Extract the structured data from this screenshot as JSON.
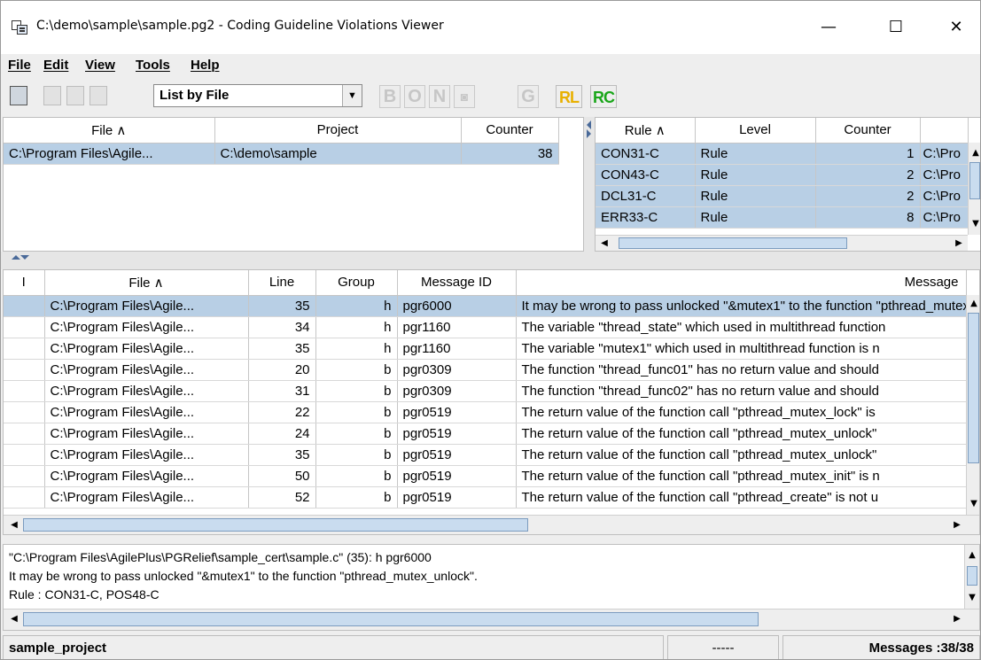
{
  "window": {
    "title": "C:\\demo\\sample\\sample.pg2 - Coding Guideline Violations Viewer",
    "minimize": "—",
    "maximize": "☐",
    "close": "✕"
  },
  "menu": [
    "File",
    "Edit",
    "View",
    "Tools",
    "Help"
  ],
  "toolbar": {
    "view_mode": "List by File",
    "letter_buttons": [
      "B",
      "O",
      "N",
      "◙",
      "G"
    ],
    "rl_label": "RL",
    "rc_label": "RC",
    "rl_color": "#e8b000",
    "rc_color": "#1aa61a"
  },
  "file_table": {
    "headers": [
      "File  ∧",
      "Project",
      "Counter"
    ],
    "rows": [
      {
        "file": "C:\\Program Files\\Agile...",
        "project": "C:\\demo\\sample",
        "counter": "38"
      }
    ]
  },
  "rule_table": {
    "headers": [
      "Rule  ∧",
      "Level",
      "Counter",
      ""
    ],
    "rows": [
      {
        "rule": "CON31-C",
        "level": "Rule",
        "counter": "1",
        "path": "C:\\Pro"
      },
      {
        "rule": "CON43-C",
        "level": "Rule",
        "counter": "2",
        "path": "C:\\Pro"
      },
      {
        "rule": "DCL31-C",
        "level": "Rule",
        "counter": "2",
        "path": "C:\\Pro"
      },
      {
        "rule": "ERR33-C",
        "level": "Rule",
        "counter": "8",
        "path": "C:\\Pro"
      }
    ]
  },
  "msg_table": {
    "headers": [
      "I",
      "File  ∧",
      "Line",
      "Group",
      "Message ID",
      "Message"
    ],
    "rows": [
      {
        "i": "",
        "file": "C:\\Program Files\\Agile...",
        "line": "35",
        "group": "h",
        "id": "pgr6000",
        "msg": "It may be wrong to pass unlocked \"&mutex1\" to the function \"pthread_mutex_unlock\"."
      },
      {
        "i": "",
        "file": "C:\\Program Files\\Agile...",
        "line": "34",
        "group": "h",
        "id": "pgr1160",
        "msg": "The variable \"thread_state\" which used in multithread function"
      },
      {
        "i": "",
        "file": "C:\\Program Files\\Agile...",
        "line": "35",
        "group": "h",
        "id": "pgr1160",
        "msg": "The variable \"mutex1\" which used in multithread function is n"
      },
      {
        "i": "",
        "file": "C:\\Program Files\\Agile...",
        "line": "20",
        "group": "b",
        "id": "pgr0309",
        "msg": "The function \"thread_func01\" has no return value and should"
      },
      {
        "i": "",
        "file": "C:\\Program Files\\Agile...",
        "line": "31",
        "group": "b",
        "id": "pgr0309",
        "msg": "The function \"thread_func02\" has no return value and should"
      },
      {
        "i": "",
        "file": "C:\\Program Files\\Agile...",
        "line": "22",
        "group": "b",
        "id": "pgr0519",
        "msg": "The return value of the function call \"pthread_mutex_lock\" is"
      },
      {
        "i": "",
        "file": "C:\\Program Files\\Agile...",
        "line": "24",
        "group": "b",
        "id": "pgr0519",
        "msg": "The return value of the function call \"pthread_mutex_unlock\""
      },
      {
        "i": "",
        "file": "C:\\Program Files\\Agile...",
        "line": "35",
        "group": "b",
        "id": "pgr0519",
        "msg": "The return value of the function call \"pthread_mutex_unlock\""
      },
      {
        "i": "",
        "file": "C:\\Program Files\\Agile...",
        "line": "50",
        "group": "b",
        "id": "pgr0519",
        "msg": "The return value of the function call \"pthread_mutex_init\" is n"
      },
      {
        "i": "",
        "file": "C:\\Program Files\\Agile...",
        "line": "52",
        "group": "b",
        "id": "pgr0519",
        "msg": "The return value of the function call \"pthread_create\" is not u"
      }
    ]
  },
  "detail": {
    "line1": "\"C:\\Program Files\\AgilePlus\\PGRelief\\sample_cert\\sample.c\" (35): h pgr6000",
    "line2": "It may be wrong to pass unlocked \"&mutex1\" to the function \"pthread_mutex_unlock\".",
    "line3": "Rule : CON31-C, POS48-C"
  },
  "statusbar": {
    "project": "sample_project",
    "middle": "-----",
    "messages": "Messages :38/38"
  }
}
